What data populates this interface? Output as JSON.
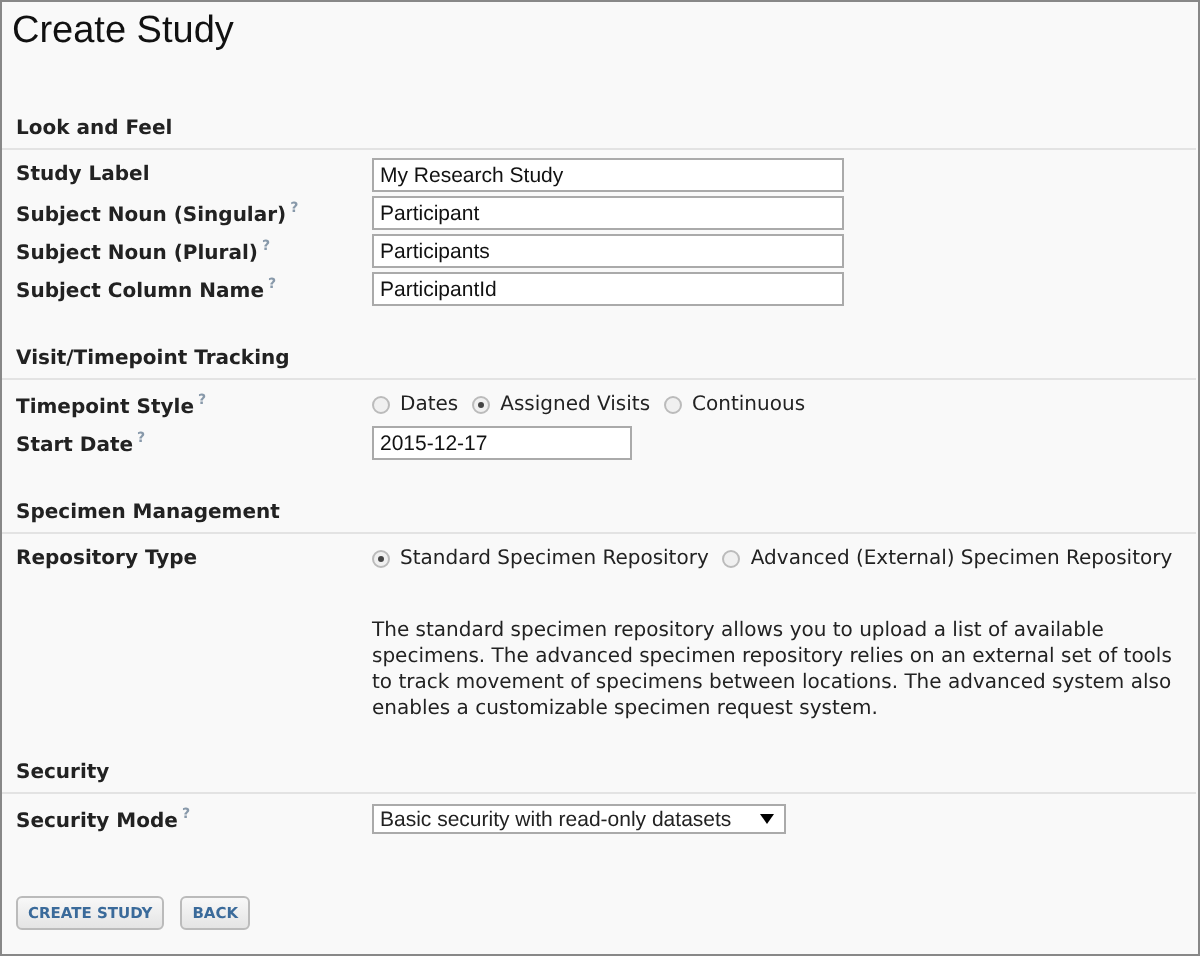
{
  "title": "Create Study",
  "sections": [
    {
      "heading": "Look and Feel",
      "fields": [
        {
          "kind": "text",
          "label": "Study Label",
          "value": "My Research Study"
        },
        {
          "kind": "text",
          "label": "Subject Noun (Singular)",
          "help": "?",
          "value": "Participant"
        },
        {
          "kind": "text",
          "label": "Subject Noun (Plural)",
          "help": "?",
          "value": "Participants"
        },
        {
          "kind": "text",
          "label": "Subject Column Name",
          "help": "?",
          "value": "ParticipantId"
        }
      ]
    },
    {
      "heading": "Visit/Timepoint Tracking",
      "fields": [
        {
          "kind": "radio",
          "label": "Timepoint Style",
          "help": "?",
          "options": [
            {
              "label": "Dates",
              "selected": false
            },
            {
              "label": "Assigned Visits",
              "selected": true
            },
            {
              "label": "Continuous",
              "selected": false
            }
          ]
        },
        {
          "kind": "date",
          "label": "Start Date",
          "help": "?",
          "value": "2015-12-17"
        }
      ]
    },
    {
      "heading": "Specimen Management",
      "fields": [
        {
          "kind": "radio",
          "label": "Repository Type",
          "options": [
            {
              "label": "Standard Specimen Repository",
              "selected": true
            },
            {
              "label": "Advanced (External) Specimen Repository",
              "selected": false
            }
          ]
        },
        {
          "kind": "note",
          "text": "The standard specimen repository allows you to upload a list of available specimens. The advanced specimen repository relies on an external set of tools to track movement of specimens between locations. The advanced system also enables a customizable specimen request system."
        }
      ]
    },
    {
      "heading": "Security",
      "fields": [
        {
          "kind": "select",
          "label": "Security Mode",
          "help": "?",
          "value": "Basic security with read-only datasets"
        }
      ]
    }
  ],
  "buttons": [
    "CREATE STUDY",
    "BACK"
  ]
}
